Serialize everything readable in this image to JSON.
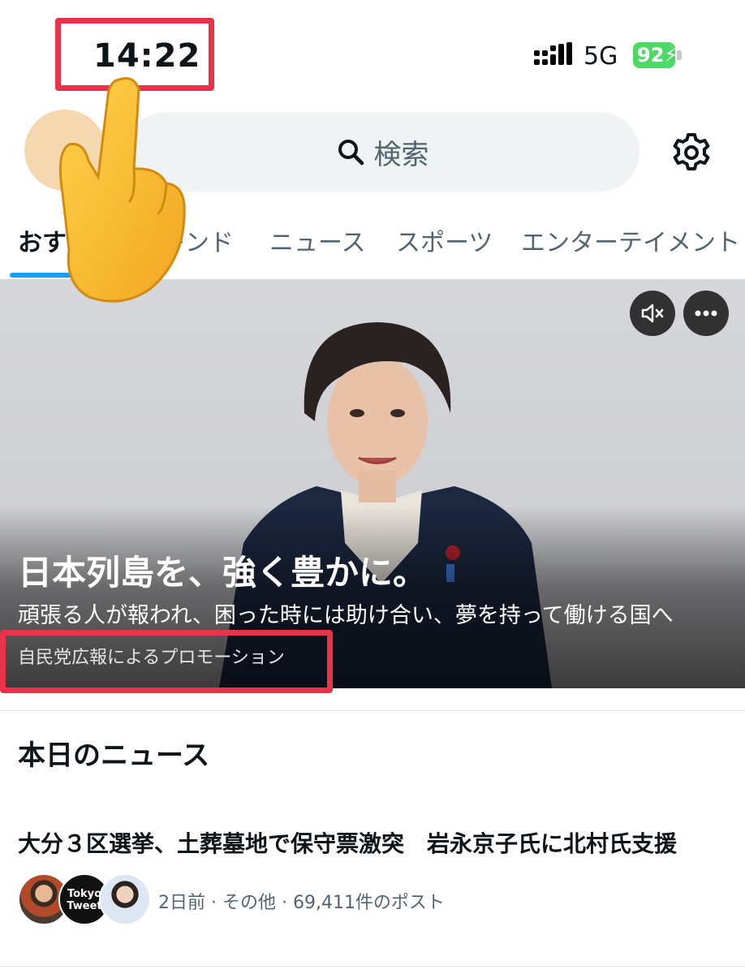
{
  "status_bar": {
    "time": "14:22",
    "network": "5G",
    "battery": "92"
  },
  "search": {
    "label": "検索"
  },
  "tabs": [
    {
      "label": "おすすめ",
      "active": true
    },
    {
      "label": "トレンド",
      "active": false
    },
    {
      "label": "ニュース",
      "active": false
    },
    {
      "label": "スポーツ",
      "active": false
    },
    {
      "label": "エンターテイメント",
      "active": false
    }
  ],
  "promo": {
    "title": "日本列島を、強く豊かに。",
    "subtitle": "頑張る人が報われ、困った時には助け合い、夢を持って働ける国へ",
    "sponsor": "自民党広報によるプロモーション"
  },
  "news": {
    "section_title": "本日のニュース",
    "items": [
      {
        "headline": "大分３区選挙、土葬墓地で保守票激突　岩永京子氏に北村氏支援",
        "meta": "2日前 · その他 · 69,411件のポスト",
        "avatar_badge": "Tokyo Tweet"
      }
    ]
  },
  "colors": {
    "accent": "#1d9bf0",
    "highlight": "#e8334a",
    "battery": "#4cd964"
  }
}
